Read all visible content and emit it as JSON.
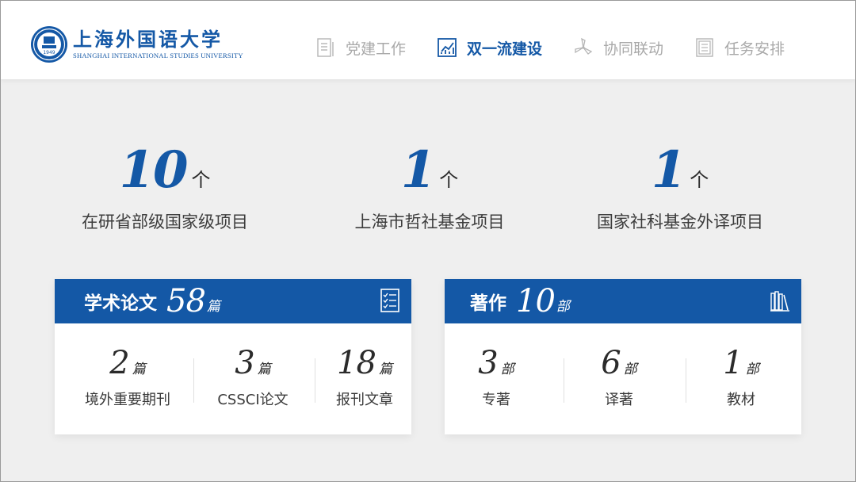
{
  "logo": {
    "name_cn": "上海外国语大学",
    "name_en": "SHANGHAI INTERNATIONAL STUDIES UNIVERSITY",
    "badge_year": "1949"
  },
  "nav": [
    {
      "label": "党建工作",
      "icon": "document-icon",
      "active": false
    },
    {
      "label": "双一流建设",
      "icon": "chart-icon",
      "active": true
    },
    {
      "label": "协同联动",
      "icon": "windmill-icon",
      "active": false
    },
    {
      "label": "任务安排",
      "icon": "checklist-icon",
      "active": false
    }
  ],
  "stats": [
    {
      "value": "10",
      "unit": "个",
      "label": "在研省部级国家级项目"
    },
    {
      "value": "1",
      "unit": "个",
      "label": "上海市哲社基金项目"
    },
    {
      "value": "1",
      "unit": "个",
      "label": "国家社科基金外译项目"
    }
  ],
  "cards": [
    {
      "title": "学术论文",
      "count": "58",
      "unit": "篇",
      "icon": "article-list-icon",
      "items": [
        {
          "value": "2",
          "unit": "篇",
          "label": "境外重要期刊"
        },
        {
          "value": "3",
          "unit": "篇",
          "label": "CSSCI论文"
        },
        {
          "value": "18",
          "unit": "篇",
          "label": "报刊文章"
        }
      ]
    },
    {
      "title": "著作",
      "count": "10",
      "unit": "部",
      "icon": "bookshelf-icon",
      "items": [
        {
          "value": "3",
          "unit": "部",
          "label": "专著"
        },
        {
          "value": "6",
          "unit": "部",
          "label": "译著"
        },
        {
          "value": "1",
          "unit": "部",
          "label": "教材"
        }
      ]
    }
  ],
  "colors": {
    "brand_blue": "#1458a6",
    "nav_inactive": "#a9a9a9",
    "background": "#efefef"
  }
}
